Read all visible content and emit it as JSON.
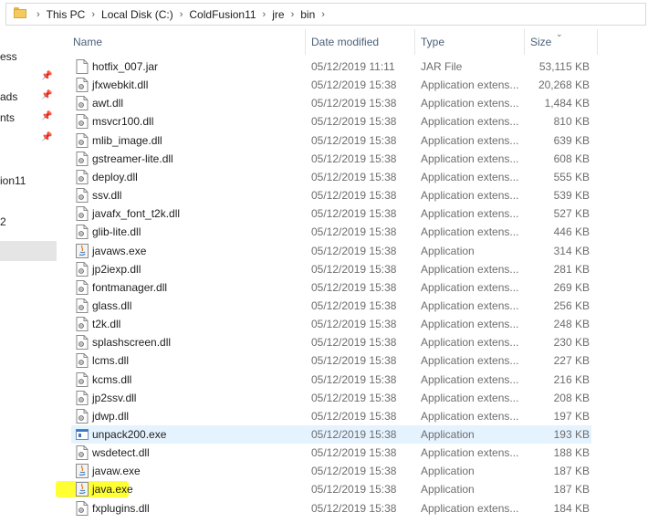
{
  "breadcrumb": [
    "This PC",
    "Local Disk (C:)",
    "ColdFusion11",
    "jre",
    "bin"
  ],
  "nav": [
    {
      "label": "ess",
      "pin": false
    },
    {
      "label": "",
      "pin": true
    },
    {
      "label": "ads",
      "pin": true
    },
    {
      "label": "nts",
      "pin": true
    },
    {
      "label": "",
      "pin": true
    },
    {
      "label": "",
      "pin": false
    },
    {
      "label": "ion11",
      "pin": false
    },
    {
      "label": "",
      "pin": false
    },
    {
      "label": "2",
      "pin": false
    },
    {
      "label": "",
      "pin": false,
      "selected": true
    }
  ],
  "columns": {
    "name": "Name",
    "date": "Date modified",
    "type": "Type",
    "size": "Size"
  },
  "files": [
    {
      "name": "hotfix_007.jar",
      "date": "05/12/2019 11:11",
      "type": "JAR File",
      "size": "53,115 KB",
      "icon": "file-icon"
    },
    {
      "name": "jfxwebkit.dll",
      "date": "05/12/2019 15:38",
      "type": "Application extens...",
      "size": "20,268 KB",
      "icon": "dll-icon"
    },
    {
      "name": "awt.dll",
      "date": "05/12/2019 15:38",
      "type": "Application extens...",
      "size": "1,484 KB",
      "icon": "dll-icon"
    },
    {
      "name": "msvcr100.dll",
      "date": "05/12/2019 15:38",
      "type": "Application extens...",
      "size": "810 KB",
      "icon": "dll-icon"
    },
    {
      "name": "mlib_image.dll",
      "date": "05/12/2019 15:38",
      "type": "Application extens...",
      "size": "639 KB",
      "icon": "dll-icon"
    },
    {
      "name": "gstreamer-lite.dll",
      "date": "05/12/2019 15:38",
      "type": "Application extens...",
      "size": "608 KB",
      "icon": "dll-icon"
    },
    {
      "name": "deploy.dll",
      "date": "05/12/2019 15:38",
      "type": "Application extens...",
      "size": "555 KB",
      "icon": "dll-icon"
    },
    {
      "name": "ssv.dll",
      "date": "05/12/2019 15:38",
      "type": "Application extens...",
      "size": "539 KB",
      "icon": "dll-icon"
    },
    {
      "name": "javafx_font_t2k.dll",
      "date": "05/12/2019 15:38",
      "type": "Application extens...",
      "size": "527 KB",
      "icon": "dll-icon"
    },
    {
      "name": "glib-lite.dll",
      "date": "05/12/2019 15:38",
      "type": "Application extens...",
      "size": "446 KB",
      "icon": "dll-icon"
    },
    {
      "name": "javaws.exe",
      "date": "05/12/2019 15:38",
      "type": "Application",
      "size": "314 KB",
      "icon": "java-icon"
    },
    {
      "name": "jp2iexp.dll",
      "date": "05/12/2019 15:38",
      "type": "Application extens...",
      "size": "281 KB",
      "icon": "dll-icon"
    },
    {
      "name": "fontmanager.dll",
      "date": "05/12/2019 15:38",
      "type": "Application extens...",
      "size": "269 KB",
      "icon": "dll-icon"
    },
    {
      "name": "glass.dll",
      "date": "05/12/2019 15:38",
      "type": "Application extens...",
      "size": "256 KB",
      "icon": "dll-icon"
    },
    {
      "name": "t2k.dll",
      "date": "05/12/2019 15:38",
      "type": "Application extens...",
      "size": "248 KB",
      "icon": "dll-icon"
    },
    {
      "name": "splashscreen.dll",
      "date": "05/12/2019 15:38",
      "type": "Application extens...",
      "size": "230 KB",
      "icon": "dll-icon"
    },
    {
      "name": "lcms.dll",
      "date": "05/12/2019 15:38",
      "type": "Application extens...",
      "size": "227 KB",
      "icon": "dll-icon"
    },
    {
      "name": "kcms.dll",
      "date": "05/12/2019 15:38",
      "type": "Application extens...",
      "size": "216 KB",
      "icon": "dll-icon"
    },
    {
      "name": "jp2ssv.dll",
      "date": "05/12/2019 15:38",
      "type": "Application extens...",
      "size": "208 KB",
      "icon": "dll-icon"
    },
    {
      "name": "jdwp.dll",
      "date": "05/12/2019 15:38",
      "type": "Application extens...",
      "size": "197 KB",
      "icon": "dll-icon"
    },
    {
      "name": "unpack200.exe",
      "date": "05/12/2019 15:38",
      "type": "Application",
      "size": "193 KB",
      "icon": "exe-icon",
      "hover": true
    },
    {
      "name": "wsdetect.dll",
      "date": "05/12/2019 15:38",
      "type": "Application extens...",
      "size": "188 KB",
      "icon": "dll-icon"
    },
    {
      "name": "javaw.exe",
      "date": "05/12/2019 15:38",
      "type": "Application",
      "size": "187 KB",
      "icon": "java-icon"
    },
    {
      "name": "java.exe",
      "date": "05/12/2019 15:38",
      "type": "Application",
      "size": "187 KB",
      "icon": "java-icon",
      "highlight": true
    },
    {
      "name": "fxplugins.dll",
      "date": "05/12/2019 15:38",
      "type": "Application extens...",
      "size": "184 KB",
      "icon": "dll-icon"
    }
  ],
  "colors": {
    "hover_row": "#e5f3ff",
    "highlight": "#ffff33",
    "header_text": "#4c607a",
    "meta_text": "#6d6d6d"
  }
}
